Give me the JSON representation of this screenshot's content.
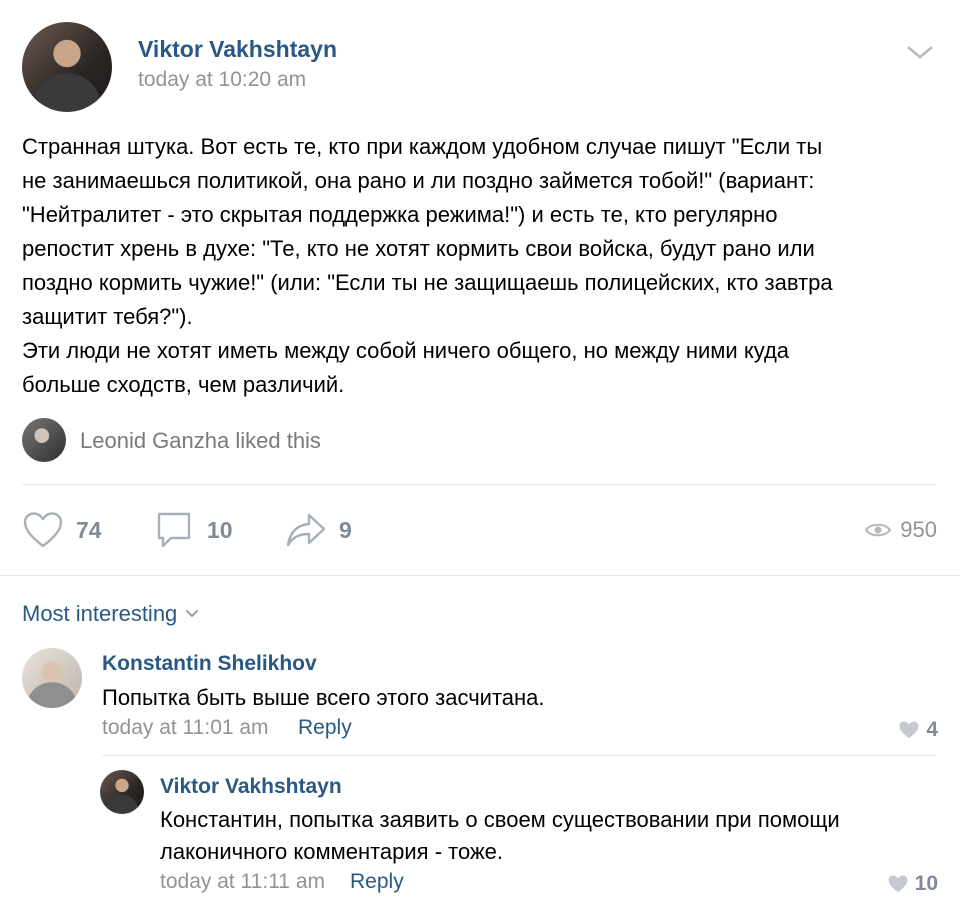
{
  "post": {
    "author": "Viktor Vakhshtayn",
    "time": "today at 10:20 am",
    "text_lines": [
      "Странная штука. Вот есть те, кто при каждом удобном случае пишут \"Если ты",
      "не занимаешься политикой, она рано и ли поздно займется тобой!\" (вариант:",
      "\"Нейтралитет - это скрытая поддержка режима!\") и есть те, кто регулярно",
      "репостит хрень в духе: \"Те, кто не хотят кормить свои войска, будут рано или",
      "поздно кормить чужие!\" (или: \"Если ты не защищаешь полицейских, кто завтра",
      "защитит тебя?\").",
      "Эти люди не хотят иметь между собой ничего общего, но между ними куда",
      "больше сходств, чем различий."
    ],
    "liked_by": "Leonid Ganzha liked this",
    "likes": "74",
    "comments": "10",
    "shares": "9",
    "views": "950"
  },
  "comments_section": {
    "sort_label": "Most interesting",
    "comments": [
      {
        "author": "Konstantin Shelikhov",
        "text_lines": [
          "Попытка быть выше всего этого засчитана."
        ],
        "time": "today at 11:01 am",
        "reply_label": "Reply",
        "likes": "4"
      },
      {
        "author": "Viktor Vakhshtayn",
        "text_lines": [
          "Константин, попытка заявить о своем существовании при помощи",
          "лаконичного комментария - тоже."
        ],
        "time": "today at 11:11 am",
        "reply_label": "Reply",
        "likes": "10"
      }
    ]
  },
  "icons": {
    "post_menu": "chevron-down-icon",
    "like": "heart-icon",
    "comment": "comment-bubble-icon",
    "share": "share-arrow-icon",
    "views": "eye-icon",
    "sort": "chevron-down-icon",
    "comment_like": "heart-icon"
  },
  "colors": {
    "link": "#2a5885",
    "muted": "#939393",
    "divider": "#e7e8ec"
  }
}
